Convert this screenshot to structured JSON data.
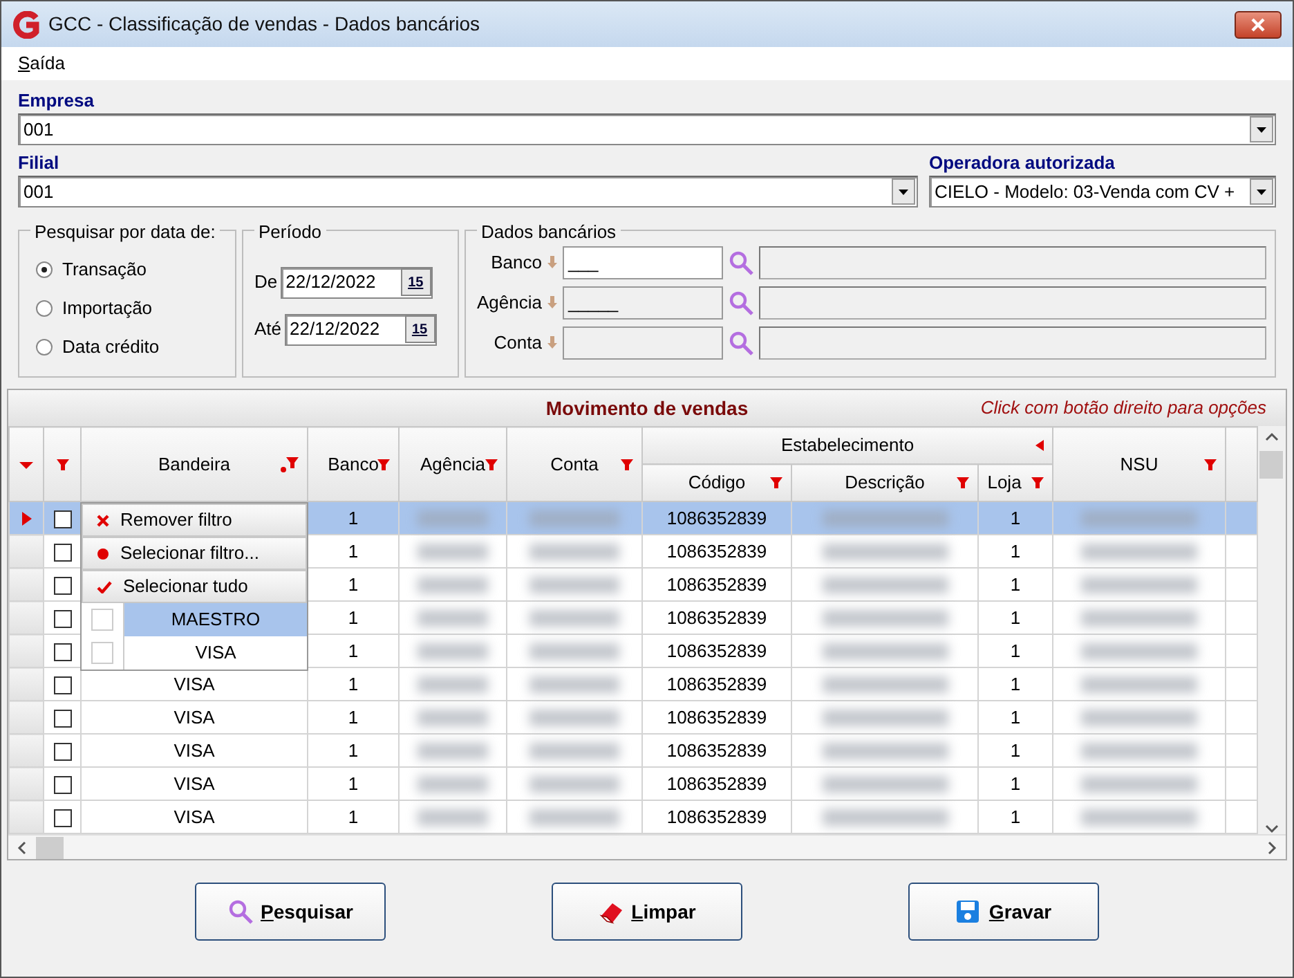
{
  "window": {
    "title": "GCC - Classificação de vendas - Dados bancários"
  },
  "menu": [
    {
      "label": "Saída"
    }
  ],
  "empresa": {
    "label": "Empresa",
    "value": "001"
  },
  "filial": {
    "label": "Filial",
    "value": "001"
  },
  "operadora": {
    "label": "Operadora autorizada",
    "value": "CIELO - Modelo: 03-Venda com CV +"
  },
  "date_search": {
    "title": "Pesquisar por data de:",
    "options": [
      {
        "label": "Transação",
        "selected": true
      },
      {
        "label": "Importação",
        "selected": false
      },
      {
        "label": "Data crédito",
        "selected": false
      }
    ]
  },
  "periodo": {
    "title": "Período",
    "fields": [
      {
        "label": "De",
        "value": "22/12/2022",
        "calendar": "15"
      },
      {
        "label": "Até",
        "value": "22/12/2022",
        "calendar": "15"
      }
    ]
  },
  "dados_bancarios": {
    "title": "Dados bancários",
    "fields": [
      {
        "label": "Banco",
        "value": "___",
        "disabled": false
      },
      {
        "label": "Agência",
        "value": "_____",
        "disabled": true
      },
      {
        "label": "Conta",
        "disabled": true
      }
    ]
  },
  "grid": {
    "title": "Movimento de vendas",
    "hint": "Click com botão direito para opções",
    "group_header": "Estabelecimento",
    "columns": [
      {
        "label": "Bandeira",
        "filtered": true
      },
      {
        "label": "Banco",
        "filtered": false
      },
      {
        "label": "Agência",
        "filtered": false
      },
      {
        "label": "Conta",
        "filtered": false
      },
      {
        "label": "Código",
        "filtered": false
      },
      {
        "label": "Descrição",
        "filtered": false
      },
      {
        "label": "Loja",
        "filtered": false
      },
      {
        "label": "NSU",
        "filtered": false
      }
    ],
    "rows": [
      {
        "selected": true,
        "checked": false,
        "banco": "1",
        "codigo": "1086352839",
        "loja": "1"
      },
      {
        "selected": false,
        "checked": false,
        "banco": "1",
        "codigo": "1086352839",
        "loja": "1"
      },
      {
        "selected": false,
        "checked": false,
        "banco": "1",
        "codigo": "1086352839",
        "loja": "1"
      },
      {
        "selected": false,
        "checked": false,
        "banco": "1",
        "codigo": "1086352839",
        "loja": "1"
      },
      {
        "selected": false,
        "checked": false,
        "banco": "1",
        "codigo": "1086352839",
        "loja": "1"
      },
      {
        "selected": false,
        "checked": false,
        "bandeira": "VISA",
        "banco": "1",
        "codigo": "1086352839",
        "loja": "1"
      },
      {
        "selected": false,
        "checked": false,
        "bandeira": "VISA",
        "banco": "1",
        "codigo": "1086352839",
        "loja": "1"
      },
      {
        "selected": false,
        "checked": false,
        "bandeira": "VISA",
        "banco": "1",
        "codigo": "1086352839",
        "loja": "1"
      },
      {
        "selected": false,
        "checked": false,
        "bandeira": "VISA",
        "banco": "1",
        "codigo": "1086352839",
        "loja": "1"
      },
      {
        "selected": false,
        "checked": false,
        "bandeira": "VISA",
        "banco": "1",
        "codigo": "1086352839",
        "loja": "1"
      }
    ]
  },
  "filter_popup": {
    "actions": [
      {
        "kind": "remove",
        "label": "Remover filtro"
      },
      {
        "kind": "select",
        "label": "Selecionar filtro..."
      },
      {
        "kind": "all",
        "label": "Selecionar tudo"
      }
    ],
    "values": [
      {
        "label": "MAESTRO",
        "selected": true,
        "checked": false
      },
      {
        "label": "VISA",
        "selected": false,
        "checked": false
      }
    ]
  },
  "buttons": [
    {
      "kind": "search",
      "label": "Pesquisar"
    },
    {
      "kind": "clear",
      "label": "Limpar"
    },
    {
      "kind": "save",
      "label": "Gravar"
    }
  ]
}
